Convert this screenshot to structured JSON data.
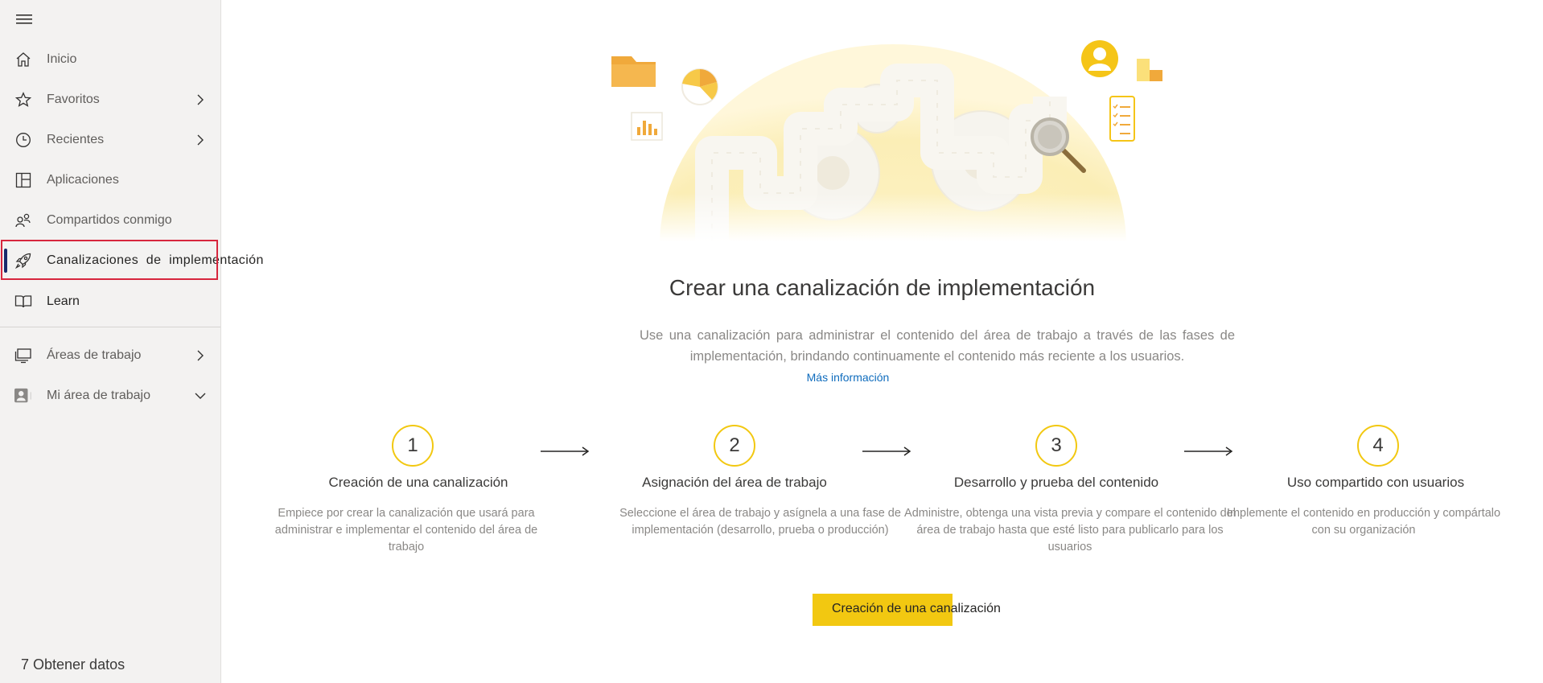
{
  "sidebar": {
    "menu_icon": "hamburger-icon",
    "items": [
      {
        "label": "Inicio",
        "icon": "home-icon"
      },
      {
        "label": "Favoritos",
        "icon": "star-icon",
        "chevron": "right"
      },
      {
        "label": "Recientes",
        "icon": "clock-icon",
        "chevron": "right"
      },
      {
        "label": "Aplicaciones",
        "icon": "apps-icon"
      },
      {
        "label": "Compartidos conmigo",
        "icon": "people-icon"
      },
      {
        "label": "Canalizaciones  de  implementación",
        "icon": "rocket-icon",
        "active": true
      },
      {
        "label": "Learn",
        "icon": "book-icon"
      },
      {
        "label": "Áreas de trabajo",
        "icon": "workspaces-icon",
        "chevron": "right"
      },
      {
        "label": "Mi área de trabajo",
        "icon": "user-workspace-icon",
        "chevron": "down"
      }
    ],
    "get_data": "7 Obtener datos"
  },
  "main": {
    "title": "Crear una canalización de implementación",
    "description": "Use una canalización para administrar el contenido del área de trabajo a través de las fases de implementación, brindando continuamente el contenido más reciente a los usuarios.",
    "more_link": "Más información",
    "steps": [
      {
        "number": "1",
        "title": "Creación de una canalización",
        "desc": "Empiece por crear la canalización que usará para administrar e implementar el contenido del área de trabajo"
      },
      {
        "number": "2",
        "title": "Asignación del área de trabajo",
        "desc": "Seleccione el área de trabajo y asígnela a una fase de implementación (desarrollo, prueba o producción)"
      },
      {
        "number": "3",
        "title": "Desarrollo y prueba del contenido",
        "desc": "Administre, obtenga una vista previa y compare el contenido del área de trabajo hasta que esté listo para publicarlo para los usuarios"
      },
      {
        "number": "4",
        "title": "Uso compartido con usuarios",
        "desc": "Implemente el contenido en producción y compártalo con su organización"
      }
    ],
    "create_button": "Creación de una canalización"
  },
  "colors": {
    "accent": "#f2c811",
    "active_indicator": "#1b2a6b",
    "highlight_border": "#d7263d",
    "link": "#0f6cbd"
  }
}
